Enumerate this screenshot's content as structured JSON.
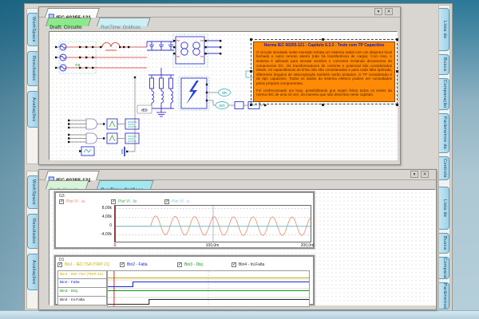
{
  "icons": {
    "check": "✓",
    "collapse": "▾",
    "close": "✕"
  },
  "doc_tab": "IEC 60255-121",
  "dock": {
    "left": [
      "WorkSpace",
      "Resultados",
      "Avaliações"
    ],
    "right": [
      "Lista de Constantes",
      "Busca",
      "Comparação",
      "Parâmetros de Ajuste",
      "Controle",
      "Lista de Constantes",
      "Busca",
      "Comparação",
      "Parâmetros de Ajuste"
    ]
  },
  "panels": {
    "top": {
      "tab_draft": "Draft: Circuito",
      "tab_runtime": "RunTime: Gráficos"
    },
    "bottom": {
      "tab_draft": "Draft: Circuito",
      "tab_runtime": "RunTime: Gráficos"
    }
  },
  "note": {
    "title": "Norma IEC 60255-121 - Capítulo 6.3.3 - Teste com TP Capacitivo",
    "body1": "O circuito simulado neste exemplo retrata um sistema radial com um disjuntor local fechado e outro remoto aberto (não há transferência de carga). Com isso, o sistema é utilizado para simular tensões e correntes incluindo decaimento da componente DC. Os transformadores de corrente e potencial são considerados ideais. As capacitâncias de linha não são consideradas e para cada falta aplicada, diferentes ângulos de interceptação também serão testados. O TP considerado é do tipo capacitivo. Todos os dados do sistema elétrico podem ser consultados pelos próprios componentes.",
    "body2": "Foi confeccionado um loop, possibilitando que sejam feitos todos os testes da norma IEC de uma só vez, da maneira que são descritos neste capítulo."
  },
  "circuit": {
    "labels": {
      "gb": "GB",
      "ied": "IED",
      "sr": "SR",
      "int": "INT"
    }
  },
  "chart_data": [
    {
      "id": "G3",
      "type": "line",
      "title": "",
      "xlabel": "t",
      "ylabel": "",
      "x_range_ms": [
        0,
        200
      ],
      "y_range": [
        -7000,
        9300
      ],
      "x_ticks": [
        {
          "t": 0,
          "label": "0"
        },
        {
          "t": 100,
          "label": "100,0m"
        },
        {
          "t": 200,
          "label": "200,0m"
        }
      ],
      "y_ticks": [
        {
          "v": 8000,
          "label": "8,00k"
        },
        {
          "v": 4000,
          "label": "4,00k"
        },
        {
          "v": 0,
          "label": "0"
        },
        {
          "v": -4000,
          "label": "-4,00k"
        }
      ],
      "grid": "dashed",
      "legend_position": "top-checkboxes",
      "series": [
        {
          "name": "Plot VI - ia",
          "color": "#ee8566",
          "shape": "sine",
          "start_ms": 36,
          "freq_hz": 50,
          "amplitude": 4200,
          "dc_offset": 500,
          "dc_decay_ms": 45
        },
        {
          "name": "Plot VI - ib",
          "color": "#44aa55",
          "shape": "flat",
          "value": 0
        },
        {
          "name": "Plot VI - ic",
          "color": "#85cbe8",
          "shape": "flat",
          "value": 0
        }
      ]
    },
    {
      "id": "D1",
      "type": "digital",
      "x_range_ms": [
        0,
        200
      ],
      "cursor_ms": 6.3,
      "cursor_color": "#cc1111",
      "channels": [
        {
          "name": "Bin1 - IED 7SA (TRIP 21)",
          "color": "#c9ad00",
          "segments": [
            [
              0,
              200,
              0
            ]
          ]
        },
        {
          "name": "Bin2 - Falta",
          "color": "#1228cc",
          "segments": [
            [
              0,
              25,
              0
            ],
            [
              25,
              200,
              1
            ]
          ]
        },
        {
          "name": "Bin3 - Disj",
          "color": "#0f9210",
          "segments": [
            [
              0,
              200,
              1
            ]
          ]
        },
        {
          "name": "Bin4 - Ini.Falta",
          "color": "#262626",
          "segments": [
            [
              0,
              41,
              0
            ],
            [
              41,
              200,
              1
            ]
          ]
        }
      ]
    }
  ]
}
